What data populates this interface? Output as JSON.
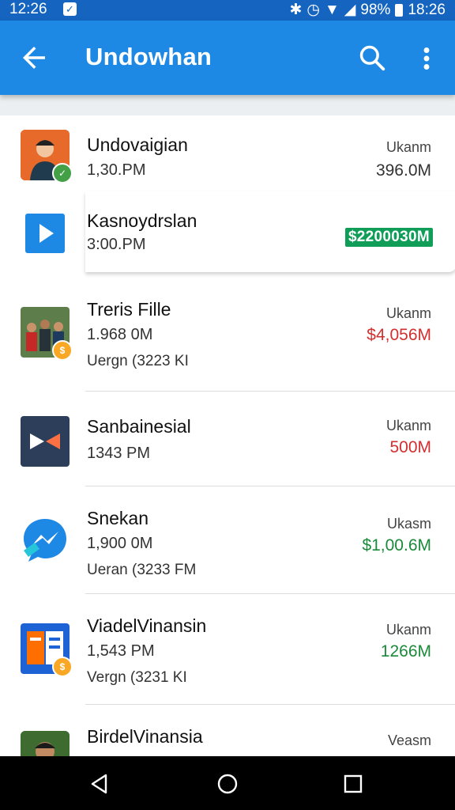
{
  "status_bar": {
    "time": "12:26",
    "battery_percent": "98%",
    "clock_right": "18:26",
    "app_icon": "notification-app-icon"
  },
  "app_bar": {
    "title": "Undowhan",
    "back_icon": "arrow-back-icon",
    "search_icon": "search-icon",
    "more_icon": "more-vert-icon",
    "color": "#1e88e5"
  },
  "items": [
    {
      "name": "Undovaigian",
      "time": "1,30.PM",
      "status": "Ukanm",
      "amount": "396.0M",
      "amount_color": "#333333",
      "thumb": "avatar-person",
      "badge_color": "#43a047"
    },
    {
      "name": "Kasnoydrslan",
      "time": "3:00.PM",
      "status": "",
      "amount": "$2200030M",
      "amount_color": "#0f9d58",
      "thumb": "play-icon"
    },
    {
      "name": "Treris Fille",
      "time": "1.968 0M",
      "sub": "Uergn (3223 KI",
      "status": "Ukanm",
      "amount": "$4,056M",
      "amount_color": "#d32f2f",
      "thumb": "group-photo",
      "badge_color": "#f9a825"
    },
    {
      "name": "Sanbainesial",
      "time": "1343 PM",
      "status": "Ukanm",
      "amount": "500M",
      "amount_color": "#d32f2f",
      "thumb": "bowtie-logo"
    },
    {
      "name": "Snekan",
      "time": "1,900 0M",
      "sub": "Ueran (3233 FM",
      "status": "Ukasm",
      "amount": "$1,00.6M",
      "amount_color": "#1b8a3a",
      "thumb": "messenger-logo"
    },
    {
      "name": "ViadelVinansin",
      "time": "1,543 PM",
      "sub": "Vergn (3231 KI",
      "status": "Ukanm",
      "amount": "1266M",
      "amount_color": "#1b8a3a",
      "thumb": "document-logo",
      "badge_color": "#f9a825"
    },
    {
      "name": "BirdelVinansia",
      "time": "",
      "status": "Veasm",
      "amount": "",
      "amount_color": "#d32f2f",
      "thumb": "avatar-person-2"
    }
  ],
  "nav": {
    "back": "nav-back-icon",
    "home": "nav-home-icon",
    "recents": "nav-recents-icon"
  }
}
